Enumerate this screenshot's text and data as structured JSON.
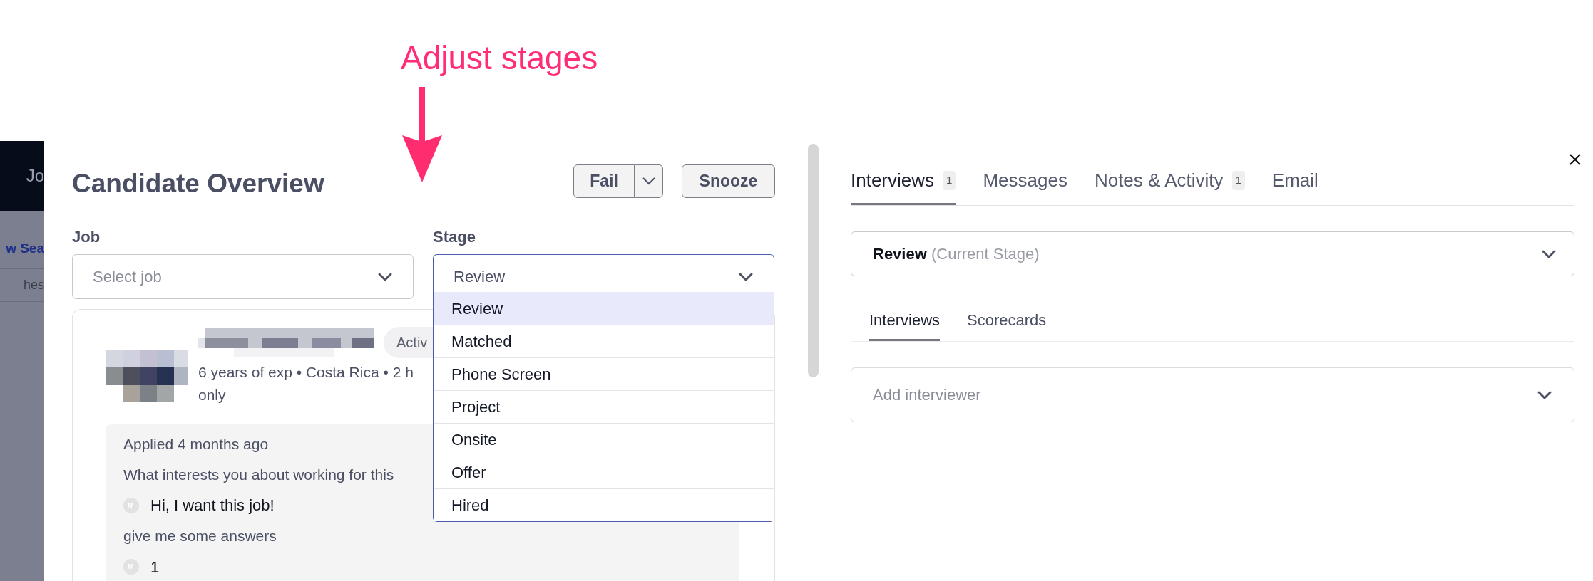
{
  "annotation": {
    "text": "Adjust stages"
  },
  "background": {
    "nav_text": "Jo",
    "link": "w Sea",
    "item": "hes"
  },
  "modal": {
    "title": "Candidate Overview",
    "actions": [
      {
        "label": "Fail",
        "kind": "split"
      },
      {
        "label": "Snooze",
        "kind": "plain"
      }
    ],
    "job": {
      "label": "Job",
      "placeholder": "Select job"
    },
    "stage": {
      "label": "Stage",
      "value": "Review",
      "expanded": true,
      "options": [
        {
          "label": "Review",
          "selected": true
        },
        {
          "label": "Matched",
          "selected": false
        },
        {
          "label": "Phone Screen",
          "selected": false
        },
        {
          "label": "Project",
          "selected": false
        },
        {
          "label": "Onsite",
          "selected": false
        },
        {
          "label": "Offer",
          "selected": false
        },
        {
          "label": "Hired",
          "selected": false
        }
      ]
    },
    "candidate": {
      "status": "Activ",
      "meta": "6 years of exp • Costa Rica • 2 h",
      "meta_more": "only",
      "applied": "Applied 4 months ago",
      "entries": [
        {
          "kind": "question",
          "text": "What interests you about working for this"
        },
        {
          "kind": "answer",
          "text": "Hi, I want this job!"
        },
        {
          "kind": "question",
          "text": "give me some answers"
        },
        {
          "kind": "answer",
          "text": "1"
        }
      ]
    }
  },
  "details": {
    "tabs": [
      {
        "label": "Interviews",
        "count": "1",
        "selected": true
      },
      {
        "label": "Messages",
        "selected": false
      },
      {
        "label": "Notes & Activity",
        "count": "1",
        "selected": false
      },
      {
        "label": "Email",
        "selected": false
      }
    ],
    "current_stage": {
      "value": "Review",
      "note": "(Current Stage)"
    },
    "subtabs": [
      {
        "label": "Interviews",
        "selected": true
      },
      {
        "label": "Scorecards",
        "selected": false
      }
    ],
    "interviewer": {
      "placeholder": "Add interviewer"
    }
  }
}
